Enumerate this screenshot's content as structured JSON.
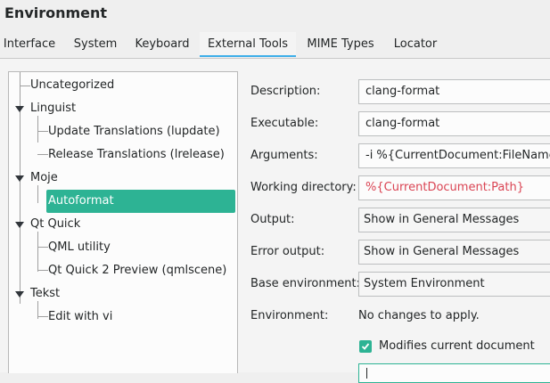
{
  "window": {
    "title": "Environment"
  },
  "tabs": [
    {
      "label": "Interface"
    },
    {
      "label": "System"
    },
    {
      "label": "Keyboard"
    },
    {
      "label": "External Tools",
      "active": true
    },
    {
      "label": "MIME Types"
    },
    {
      "label": "Locator"
    }
  ],
  "tree": {
    "items": [
      {
        "label": "Uncategorized",
        "level": 0,
        "expandable": false
      },
      {
        "label": "Linguist",
        "level": 0,
        "expandable": true
      },
      {
        "label": "Update Translations (lupdate)",
        "level": 1
      },
      {
        "label": "Release Translations (lrelease)",
        "level": 1
      },
      {
        "label": "Moje",
        "level": 0,
        "expandable": true
      },
      {
        "label": "Autoformat",
        "level": 1,
        "selected": true
      },
      {
        "label": "Qt Quick",
        "level": 0,
        "expandable": true
      },
      {
        "label": "QML utility",
        "level": 1
      },
      {
        "label": "Qt Quick 2 Preview (qmlscene)",
        "level": 1
      },
      {
        "label": "Tekst",
        "level": 0,
        "expandable": true
      },
      {
        "label": "Edit with vi",
        "level": 1
      }
    ]
  },
  "form": {
    "description": {
      "label": "Description:",
      "value": "clang-format"
    },
    "executable": {
      "label": "Executable:",
      "value": "clang-format"
    },
    "arguments": {
      "label": "Arguments:",
      "value": "-i %{CurrentDocument:FileName}"
    },
    "working_directory": {
      "label": "Working directory:",
      "value": "%{CurrentDocument:Path}"
    },
    "output": {
      "label": "Output:",
      "value": "Show in General Messages"
    },
    "error_output": {
      "label": "Error output:",
      "value": "Show in General Messages"
    },
    "base_environment": {
      "label": "Base environment:",
      "value": "System Environment"
    },
    "environment": {
      "label": "Environment:",
      "value": "No changes to apply."
    },
    "modifies_document": {
      "label": "Modifies current document",
      "checked": true
    }
  },
  "colors": {
    "accent": "#2db394",
    "focus": "#3daee9",
    "variable": "#da4453"
  }
}
